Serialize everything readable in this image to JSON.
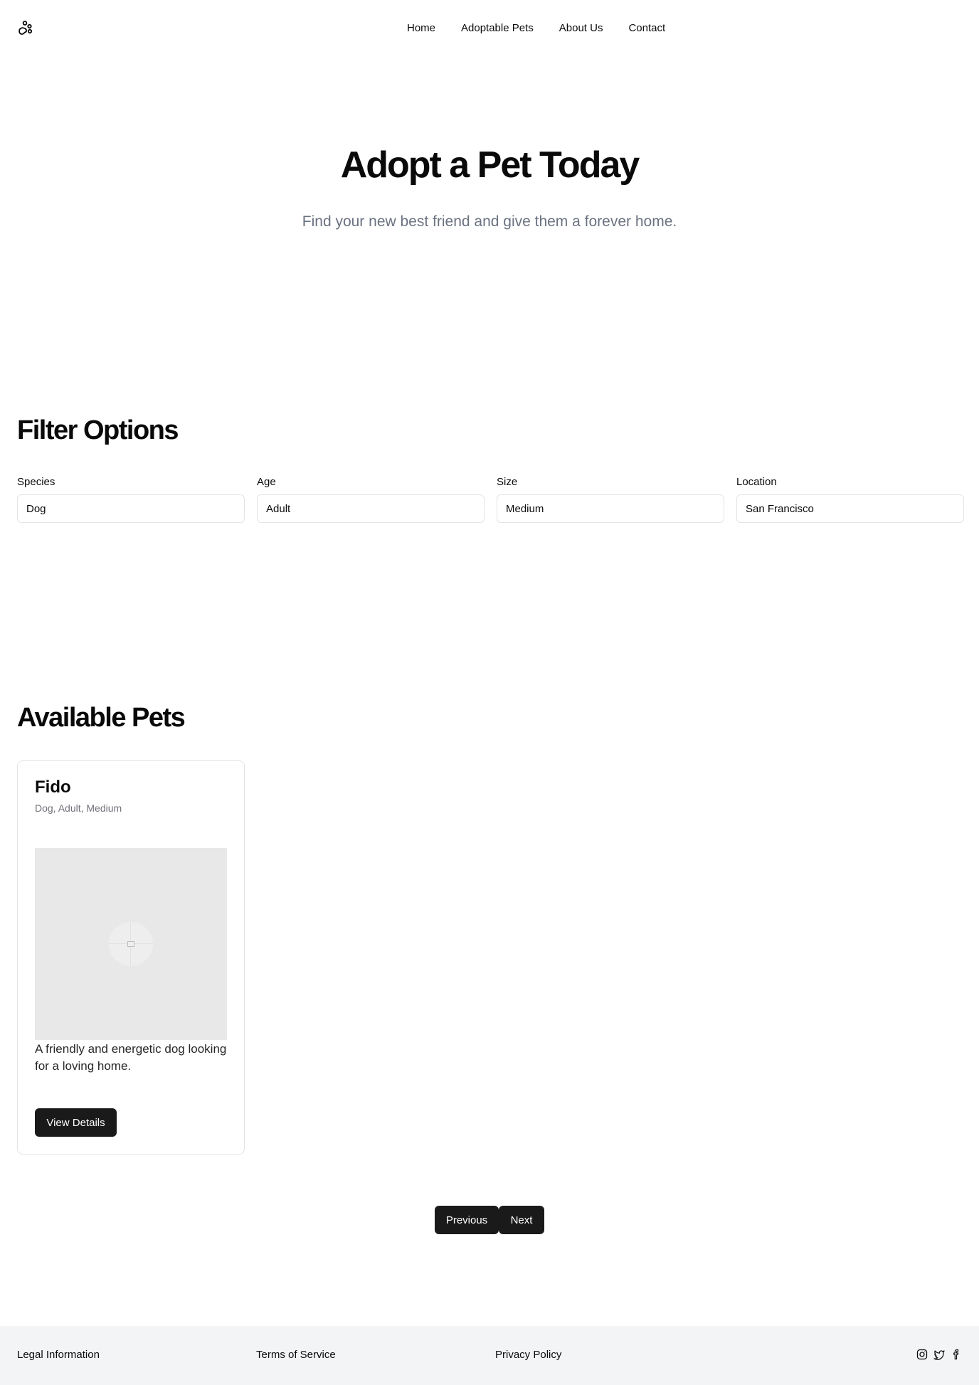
{
  "header": {
    "logo_icon": "paw-icon",
    "nav": [
      "Home",
      "Adoptable Pets",
      "About Us",
      "Contact"
    ]
  },
  "hero": {
    "title": "Adopt a Pet Today",
    "subtitle": "Find your new best friend and give them a forever home."
  },
  "filters": {
    "title": "Filter Options",
    "fields": [
      {
        "label": "Species",
        "value": "Dog"
      },
      {
        "label": "Age",
        "value": "Adult"
      },
      {
        "label": "Size",
        "value": "Medium"
      },
      {
        "label": "Location",
        "value": "San Francisco"
      }
    ]
  },
  "pets": {
    "title": "Available Pets",
    "items": [
      {
        "name": "Fido",
        "meta": "Dog, Adult, Medium",
        "image_icon": "image-placeholder-icon",
        "description": "A friendly and energetic dog looking for a loving home.",
        "button": "View Details"
      }
    ]
  },
  "pagination": {
    "previous": "Previous",
    "next": "Next"
  },
  "footer": {
    "links": [
      "Legal Information",
      "Terms of Service",
      "Privacy Policy"
    ],
    "socials": [
      "instagram-icon",
      "twitter-icon",
      "facebook-icon"
    ]
  },
  "colors": {
    "button_bg": "#1a1a1a",
    "muted_text": "#6b7280",
    "footer_bg": "#f3f4f6",
    "border": "#e4e4e7"
  }
}
